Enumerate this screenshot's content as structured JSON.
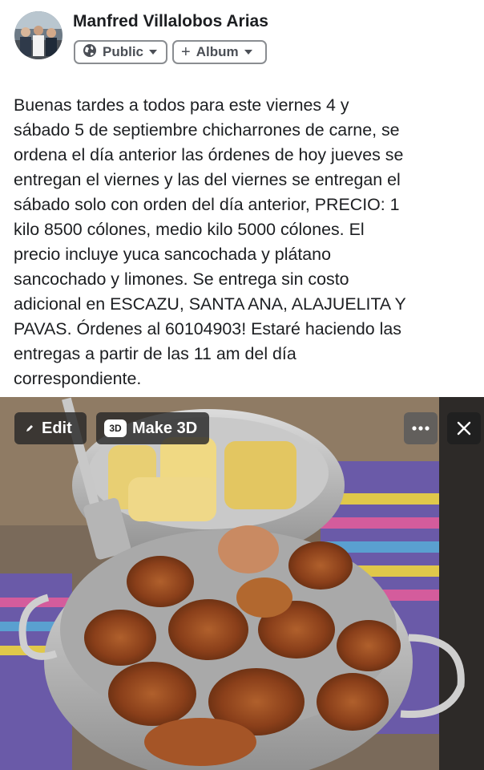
{
  "post": {
    "author": "Manfred Villalobos Arias",
    "audience_label": "Public",
    "album_label": "Album",
    "album_prefix": "+",
    "text": "Buenas tardes a todos para este viernes 4 y\nsábado 5 de septiembre chicharrones de carne, se\nordena el día anterior las órdenes de hoy jueves se\nentregan el viernes y las del viernes se entregan el\nsábado solo con orden del día anterior, PRECIO: 1\nkilo 8500 cólones, medio kilo 5000 cólones. El\nprecio incluye yuca sancochada y plátano\nsancochado y limones. Se entrega sin costo\nadicional en ESCAZU, SANTA ANA, ALAJUELITA Y\nPAVAS. Órdenes al 60104903! Estaré haciendo las\nentregas a partir de las 11 am del día\ncorrespondiente."
  },
  "photo_toolbar": {
    "edit_label": "Edit",
    "make3d_label": "Make 3D",
    "make3d_badge": "3D",
    "more_icon": "more-icon",
    "close_icon": "close-icon"
  },
  "icons": {
    "audience": "globe-icon",
    "edit": "pencil-icon"
  },
  "colors": {
    "text": "#1c1e21",
    "chip_border": "#8a8d91",
    "overlay": "#282828"
  }
}
